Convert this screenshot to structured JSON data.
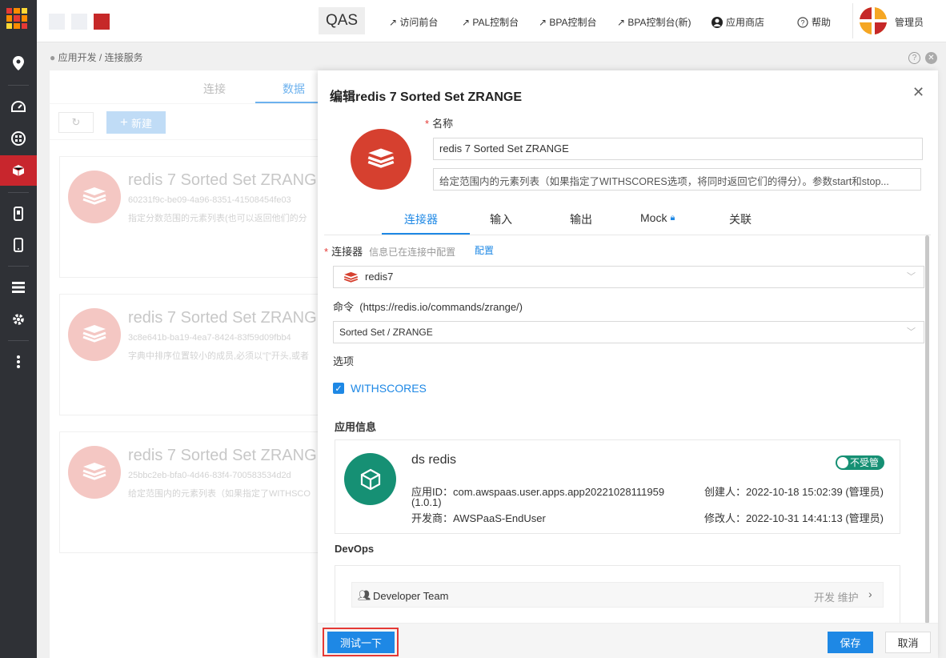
{
  "header": {
    "env": "QAS",
    "links": [
      "访问前台",
      "PAL控制台",
      "BPA控制台",
      "BPA控制台(新)"
    ],
    "app_store": "应用商店",
    "help": "帮助",
    "user": "管理员"
  },
  "sidebar": {
    "icons": [
      "location-icon",
      "dashboard-icon",
      "apps-icon",
      "cube-icon",
      "mobile-icon",
      "phone-icon",
      "list-icon",
      "gear-icon",
      "more-icon"
    ],
    "active": "cube-icon"
  },
  "breadcrumb": "应用开发 / 连接服务",
  "list": {
    "tabs": [
      "连接",
      "数据"
    ],
    "new_button": "新建",
    "cards": [
      {
        "title": "redis 7 Sorted Set ZRANG",
        "id": "60231f9c-be09-4a96-8351-41508454fe03",
        "desc": "指定分数范围的元素列表(也可以返回他们的分"
      },
      {
        "title": "redis 7 Sorted Set ZRANG",
        "id": "3c8e641b-ba19-4ea7-8424-83f59d09fbb4",
        "desc": "字典中排序位置较小的成员,必须以\"[\"开头,或者"
      },
      {
        "title": "redis 7 Sorted Set ZRANG",
        "id": "25bbc2eb-bfa0-4d46-83f4-700583534d2d",
        "desc": "给定范围内的元素列表（如果指定了WITHSCO"
      }
    ]
  },
  "drawer": {
    "title": "编辑redis 7 Sorted Set ZRANGE",
    "name_label": "名称",
    "name_value": "redis 7 Sorted Set  ZRANGE",
    "desc_value": "给定范围内的元素列表（如果指定了WITHSCORES选项，将同时返回它们的得分）。参数start和stop...",
    "tabs": [
      "连接器",
      "输入",
      "输出",
      "Mock",
      "关联"
    ],
    "active_tab": "连接器",
    "connector_label": "连接器",
    "connector_hint": "信息已在连接中配置",
    "configure_link": "配置",
    "connector_value": "redis7",
    "command_label": "命令",
    "command_link": "(https://redis.io/commands/zrange/)",
    "command_value": "Sorted Set / ZRANGE",
    "options_label": "选项",
    "option_withscores": "WITHSCORES",
    "option_checked": true,
    "app_info_title": "应用信息",
    "app": {
      "name": "ds redis",
      "toggle": "不受管",
      "app_id": "应用ID：com.awspaas.user.apps.app20221028111959",
      "version": "(1.0.1)",
      "developer": "开发商：AWSPaaS-EndUser",
      "creator": "创建人：2022-10-18 15:02:39 (管理员)",
      "modifier": "修改人：2022-10-31 14:41:13 (管理员)"
    },
    "devops_title": "DevOps",
    "team": "Developer Team",
    "team_action": "开发 维护",
    "test_button": "测试一下",
    "save_button": "保存",
    "cancel_button": "取消"
  },
  "colors": {
    "accent": "#1e88e5",
    "brand": "#c8262d",
    "redis": "#d6402f",
    "app": "#169074"
  }
}
